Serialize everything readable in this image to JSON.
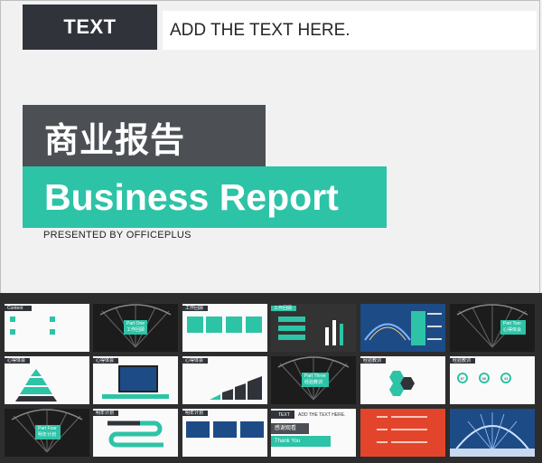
{
  "header": {
    "tag": "TEXT",
    "placeholder_text": "ADD THE TEXT HERE."
  },
  "title": {
    "cn": "商业报告",
    "en": "Business Report",
    "presented": "PRESENTED BY OFFICEPLUS"
  },
  "thumbs": {
    "t1": {
      "label": "Content"
    },
    "t2": {
      "part": "Part One",
      "name": "工作回顾"
    },
    "t3": {
      "label": "工作回顾"
    },
    "t4": {
      "label": "工作回顾"
    },
    "t6": {
      "part": "Part Two",
      "name": "心得体会"
    },
    "t7": {
      "label": "心得体会"
    },
    "t8": {
      "label": "心得体会"
    },
    "t9": {
      "label": "心得体会"
    },
    "t10": {
      "part": "Part Three",
      "name": "经验教训"
    },
    "t11": {
      "label": "经验教训"
    },
    "t12": {
      "label": "经验教训",
      "rings": [
        "87",
        "56",
        "43"
      ]
    },
    "t13": {
      "part": "Part Four",
      "name": "明年计划"
    },
    "t14": {
      "label": "明年计划"
    },
    "t15": {
      "label": "明年计划"
    },
    "t16": {
      "tag": "TEXT",
      "text": "ADD THE TEXT HERE.",
      "cn": "感谢观看",
      "en": "Thank You"
    }
  },
  "colors": {
    "accent": "#2dc3a6",
    "dark": "#30343a",
    "grey": "#4c5054",
    "red": "#e2452b"
  }
}
